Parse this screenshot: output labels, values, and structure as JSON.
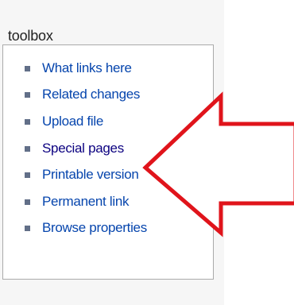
{
  "toolbox": {
    "title": "toolbox",
    "items": [
      {
        "label": "What links here",
        "visited": false
      },
      {
        "label": "Related changes",
        "visited": false
      },
      {
        "label": "Upload file",
        "visited": false
      },
      {
        "label": "Special pages",
        "visited": true
      },
      {
        "label": "Printable version",
        "visited": false
      },
      {
        "label": "Permanent link",
        "visited": false
      },
      {
        "label": "Browse properties",
        "visited": false
      }
    ]
  },
  "colors": {
    "link": "#0645ad",
    "visited_link": "#0b0080",
    "bullet": "#626f88",
    "panel_bg": "#f6f6f6",
    "box_border": "#aaaaaa",
    "arrow_outline": "#e0141b",
    "arrow_fill": "#ffffff"
  },
  "annotation": {
    "type": "arrow",
    "direction": "left",
    "points_to": "Special pages"
  }
}
